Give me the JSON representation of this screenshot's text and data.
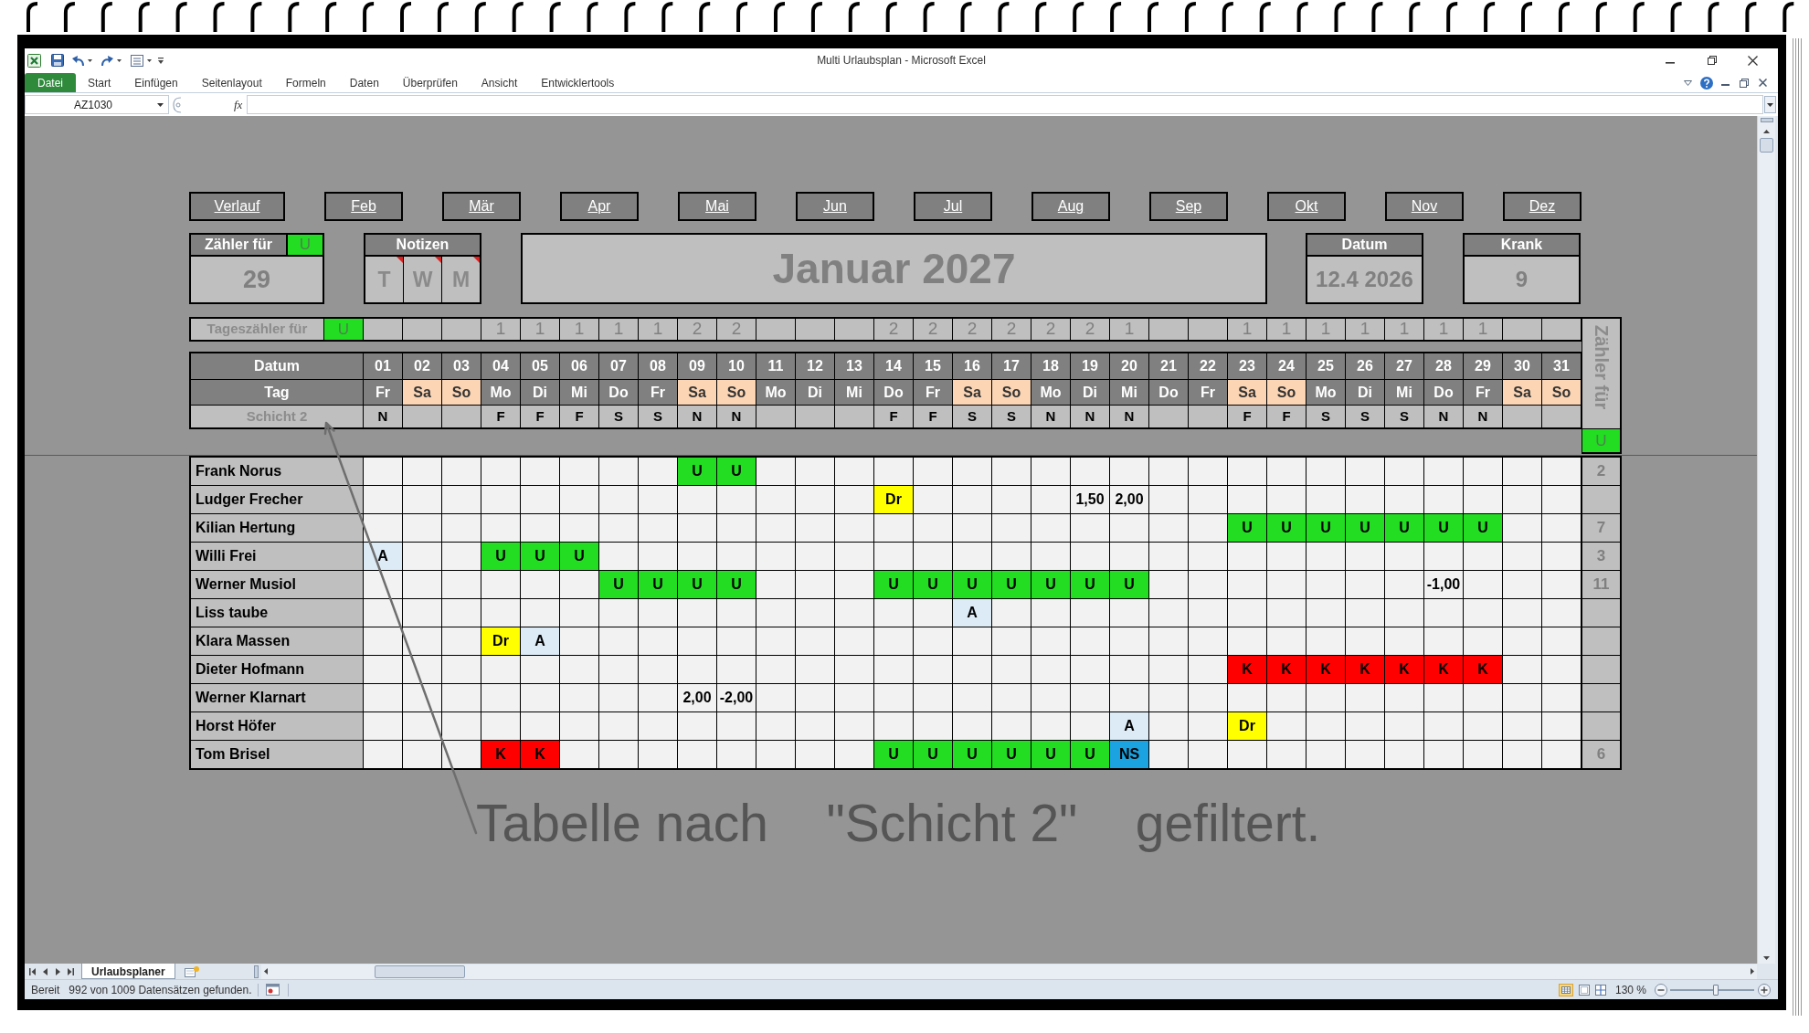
{
  "window": {
    "title": "Multi Urlaubsplan - Microsoft Excel"
  },
  "ribbon_tabs": [
    {
      "label": "Datei",
      "kind": "file"
    },
    {
      "label": "Start",
      "kind": "tab"
    },
    {
      "label": "Einfügen",
      "kind": "tab"
    },
    {
      "label": "Seitenlayout",
      "kind": "tab"
    },
    {
      "label": "Formeln",
      "kind": "tab"
    },
    {
      "label": "Daten",
      "kind": "tab"
    },
    {
      "label": "Überprüfen",
      "kind": "tab"
    },
    {
      "label": "Ansicht",
      "kind": "tab"
    },
    {
      "label": "Entwicklertools",
      "kind": "tab"
    }
  ],
  "formula_bar": {
    "name_box": "AZ1030",
    "function_button": "fx"
  },
  "month_nav": [
    "Verlauf",
    "Feb",
    "Mär",
    "Apr",
    "Mai",
    "Jun",
    "Jul",
    "Aug",
    "Sep",
    "Okt",
    "Nov",
    "Dez"
  ],
  "counter_box": {
    "title": "Zähler für",
    "code": "U",
    "value": "29"
  },
  "notes": {
    "title": "Notizen",
    "items": [
      {
        "label": "T",
        "comment": true
      },
      {
        "label": "W",
        "comment": true
      },
      {
        "label": "M",
        "comment": true
      }
    ]
  },
  "month_title": "Januar 2027",
  "date_box": {
    "title": "Datum",
    "value": "12.4 2026"
  },
  "sick_box": {
    "title": "Krank",
    "value": "9"
  },
  "day_counter": {
    "label": "Tageszähler für",
    "code": "U"
  },
  "table": {
    "header_labels": {
      "date": "Datum",
      "weekday": "Tag",
      "shift": "Schicht 2"
    },
    "days": [
      {
        "date": "01",
        "weekday": "Fr",
        "weekend": false,
        "shift": "N"
      },
      {
        "date": "02",
        "weekday": "Sa",
        "weekend": true
      },
      {
        "date": "03",
        "weekday": "So",
        "weekend": true
      },
      {
        "date": "04",
        "weekday": "Mo",
        "weekend": false,
        "count": "1",
        "shift": "F"
      },
      {
        "date": "05",
        "weekday": "Di",
        "weekend": false,
        "count": "1",
        "shift": "F"
      },
      {
        "date": "06",
        "weekday": "Mi",
        "weekend": false,
        "count": "1",
        "shift": "F"
      },
      {
        "date": "07",
        "weekday": "Do",
        "weekend": false,
        "count": "1",
        "shift": "S"
      },
      {
        "date": "08",
        "weekday": "Fr",
        "weekend": false,
        "count": "1",
        "shift": "S"
      },
      {
        "date": "09",
        "weekday": "Sa",
        "weekend": true,
        "count": "2",
        "shift": "N"
      },
      {
        "date": "10",
        "weekday": "So",
        "weekend": true,
        "count": "2",
        "shift": "N"
      },
      {
        "date": "11",
        "weekday": "Mo",
        "weekend": false
      },
      {
        "date": "12",
        "weekday": "Di",
        "weekend": false
      },
      {
        "date": "13",
        "weekday": "Mi",
        "weekend": false
      },
      {
        "date": "14",
        "weekday": "Do",
        "weekend": false,
        "count": "2",
        "shift": "F"
      },
      {
        "date": "15",
        "weekday": "Fr",
        "weekend": false,
        "count": "2",
        "shift": "F"
      },
      {
        "date": "16",
        "weekday": "Sa",
        "weekend": true,
        "count": "2",
        "shift": "S"
      },
      {
        "date": "17",
        "weekday": "So",
        "weekend": true,
        "count": "2",
        "shift": "S"
      },
      {
        "date": "18",
        "weekday": "Mo",
        "weekend": false,
        "count": "2",
        "shift": "N"
      },
      {
        "date": "19",
        "weekday": "Di",
        "weekend": false,
        "count": "2",
        "shift": "N"
      },
      {
        "date": "20",
        "weekday": "Mi",
        "weekend": false,
        "count": "1",
        "shift": "N"
      },
      {
        "date": "21",
        "weekday": "Do",
        "weekend": false
      },
      {
        "date": "22",
        "weekday": "Fr",
        "weekend": false
      },
      {
        "date": "23",
        "weekday": "Sa",
        "weekend": true,
        "count": "1",
        "shift": "F"
      },
      {
        "date": "24",
        "weekday": "So",
        "weekend": true,
        "count": "1",
        "shift": "F"
      },
      {
        "date": "25",
        "weekday": "Mo",
        "weekend": false,
        "count": "1",
        "shift": "S"
      },
      {
        "date": "26",
        "weekday": "Di",
        "weekend": false,
        "count": "1",
        "shift": "S"
      },
      {
        "date": "27",
        "weekday": "Mi",
        "weekend": false,
        "count": "1",
        "shift": "S"
      },
      {
        "date": "28",
        "weekday": "Do",
        "weekend": false,
        "count": "1",
        "shift": "N"
      },
      {
        "date": "29",
        "weekday": "Fr",
        "weekend": false,
        "count": "1",
        "shift": "N"
      },
      {
        "date": "30",
        "weekday": "Sa",
        "weekend": true
      },
      {
        "date": "31",
        "weekday": "So",
        "weekend": true
      }
    ],
    "counter_header": {
      "label": "Zähler für",
      "code": "U"
    },
    "rows": [
      {
        "name": "Frank Norus",
        "counter": "2",
        "cells": [
          {
            "kind": "blank"
          },
          {
            "kind": "blank"
          },
          {
            "kind": "blank"
          },
          {
            "kind": "blank"
          },
          {
            "kind": "blank"
          },
          {
            "kind": "blank"
          },
          {
            "kind": "blank"
          },
          {
            "kind": "blank"
          },
          {
            "kind": "code",
            "text": "U",
            "color": "#22dd22"
          },
          {
            "kind": "code",
            "text": "U",
            "color": "#22dd22"
          },
          {
            "kind": "blank"
          },
          {
            "kind": "blank"
          },
          {
            "kind": "blank"
          },
          {
            "kind": "blank"
          },
          {
            "kind": "blank"
          },
          {
            "kind": "blank"
          },
          {
            "kind": "blank"
          },
          {
            "kind": "blank"
          },
          {
            "kind": "blank"
          },
          {
            "kind": "blank"
          },
          {
            "kind": "blank"
          },
          {
            "kind": "blank"
          },
          {
            "kind": "blank"
          },
          {
            "kind": "blank"
          },
          {
            "kind": "blank"
          },
          {
            "kind": "blank"
          },
          {
            "kind": "blank"
          },
          {
            "kind": "blank"
          },
          {
            "kind": "blank"
          },
          {
            "kind": "blank"
          },
          {
            "kind": "blank"
          }
        ]
      },
      {
        "name": "Ludger Frecher",
        "cells": [
          {
            "kind": "blank"
          },
          {
            "kind": "blank"
          },
          {
            "kind": "blank"
          },
          {
            "kind": "blank"
          },
          {
            "kind": "blank"
          },
          {
            "kind": "blank"
          },
          {
            "kind": "blank"
          },
          {
            "kind": "blank"
          },
          {
            "kind": "blank"
          },
          {
            "kind": "blank"
          },
          {
            "kind": "blank"
          },
          {
            "kind": "blank"
          },
          {
            "kind": "blank"
          },
          {
            "kind": "code",
            "text": "Dr",
            "color": "#ffff00"
          },
          {
            "kind": "blank"
          },
          {
            "kind": "blank"
          },
          {
            "kind": "blank"
          },
          {
            "kind": "blank"
          },
          {
            "kind": "value",
            "text": "1,50"
          },
          {
            "kind": "value",
            "text": "2,00"
          },
          {
            "kind": "blank"
          },
          {
            "kind": "blank"
          },
          {
            "kind": "blank"
          },
          {
            "kind": "blank"
          },
          {
            "kind": "blank"
          },
          {
            "kind": "blank"
          },
          {
            "kind": "blank"
          },
          {
            "kind": "blank"
          },
          {
            "kind": "blank"
          },
          {
            "kind": "blank"
          },
          {
            "kind": "blank"
          }
        ]
      },
      {
        "name": "Kilian Hertung",
        "counter": "7",
        "cells": [
          {
            "kind": "blank"
          },
          {
            "kind": "blank"
          },
          {
            "kind": "blank"
          },
          {
            "kind": "blank"
          },
          {
            "kind": "blank"
          },
          {
            "kind": "blank"
          },
          {
            "kind": "blank"
          },
          {
            "kind": "blank"
          },
          {
            "kind": "blank"
          },
          {
            "kind": "blank"
          },
          {
            "kind": "blank"
          },
          {
            "kind": "blank"
          },
          {
            "kind": "blank"
          },
          {
            "kind": "blank"
          },
          {
            "kind": "blank"
          },
          {
            "kind": "blank"
          },
          {
            "kind": "blank"
          },
          {
            "kind": "blank"
          },
          {
            "kind": "blank"
          },
          {
            "kind": "blank"
          },
          {
            "kind": "blank"
          },
          {
            "kind": "blank"
          },
          {
            "kind": "code",
            "text": "U",
            "color": "#22dd22"
          },
          {
            "kind": "code",
            "text": "U",
            "color": "#22dd22"
          },
          {
            "kind": "code",
            "text": "U",
            "color": "#22dd22"
          },
          {
            "kind": "code",
            "text": "U",
            "color": "#22dd22"
          },
          {
            "kind": "code",
            "text": "U",
            "color": "#22dd22"
          },
          {
            "kind": "code",
            "text": "U",
            "color": "#22dd22"
          },
          {
            "kind": "code",
            "text": "U",
            "color": "#22dd22"
          },
          {
            "kind": "blank"
          },
          {
            "kind": "blank"
          }
        ]
      },
      {
        "name": "Willi Frei",
        "counter": "3",
        "cells": [
          {
            "kind": "code",
            "text": "A",
            "color": "#ddebf7"
          },
          {
            "kind": "blank"
          },
          {
            "kind": "blank"
          },
          {
            "kind": "code",
            "text": "U",
            "color": "#22dd22"
          },
          {
            "kind": "code",
            "text": "U",
            "color": "#22dd22"
          },
          {
            "kind": "code",
            "text": "U",
            "color": "#22dd22"
          },
          {
            "kind": "blank"
          },
          {
            "kind": "blank"
          },
          {
            "kind": "blank"
          },
          {
            "kind": "blank"
          },
          {
            "kind": "blank"
          },
          {
            "kind": "blank"
          },
          {
            "kind": "blank"
          },
          {
            "kind": "blank"
          },
          {
            "kind": "blank"
          },
          {
            "kind": "blank"
          },
          {
            "kind": "blank"
          },
          {
            "kind": "blank"
          },
          {
            "kind": "blank"
          },
          {
            "kind": "blank"
          },
          {
            "kind": "blank"
          },
          {
            "kind": "blank"
          },
          {
            "kind": "blank"
          },
          {
            "kind": "blank"
          },
          {
            "kind": "blank"
          },
          {
            "kind": "blank"
          },
          {
            "kind": "blank"
          },
          {
            "kind": "blank"
          },
          {
            "kind": "blank"
          },
          {
            "kind": "blank"
          },
          {
            "kind": "blank"
          }
        ]
      },
      {
        "name": "Werner Musiol",
        "counter": "11",
        "cells": [
          {
            "kind": "blank"
          },
          {
            "kind": "blank"
          },
          {
            "kind": "blank"
          },
          {
            "kind": "blank"
          },
          {
            "kind": "blank"
          },
          {
            "kind": "blank"
          },
          {
            "kind": "code",
            "text": "U",
            "color": "#22dd22"
          },
          {
            "kind": "code",
            "text": "U",
            "color": "#22dd22"
          },
          {
            "kind": "code",
            "text": "U",
            "color": "#22dd22"
          },
          {
            "kind": "code",
            "text": "U",
            "color": "#22dd22"
          },
          {
            "kind": "blank"
          },
          {
            "kind": "blank"
          },
          {
            "kind": "blank"
          },
          {
            "kind": "code",
            "text": "U",
            "color": "#22dd22"
          },
          {
            "kind": "code",
            "text": "U",
            "color": "#22dd22"
          },
          {
            "kind": "code",
            "text": "U",
            "color": "#22dd22"
          },
          {
            "kind": "code",
            "text": "U",
            "color": "#22dd22"
          },
          {
            "kind": "code",
            "text": "U",
            "color": "#22dd22"
          },
          {
            "kind": "code",
            "text": "U",
            "color": "#22dd22"
          },
          {
            "kind": "code",
            "text": "U",
            "color": "#22dd22"
          },
          {
            "kind": "blank"
          },
          {
            "kind": "blank"
          },
          {
            "kind": "blank"
          },
          {
            "kind": "blank"
          },
          {
            "kind": "blank"
          },
          {
            "kind": "blank"
          },
          {
            "kind": "blank"
          },
          {
            "kind": "value",
            "text": "-1,00"
          },
          {
            "kind": "blank"
          },
          {
            "kind": "blank"
          },
          {
            "kind": "blank"
          }
        ]
      },
      {
        "name": "Liss taube",
        "cells": [
          {
            "kind": "blank"
          },
          {
            "kind": "blank"
          },
          {
            "kind": "blank"
          },
          {
            "kind": "blank"
          },
          {
            "kind": "blank"
          },
          {
            "kind": "blank"
          },
          {
            "kind": "blank"
          },
          {
            "kind": "blank"
          },
          {
            "kind": "blank"
          },
          {
            "kind": "blank"
          },
          {
            "kind": "blank"
          },
          {
            "kind": "blank"
          },
          {
            "kind": "blank"
          },
          {
            "kind": "blank"
          },
          {
            "kind": "blank"
          },
          {
            "kind": "code",
            "text": "A",
            "color": "#ddebf7"
          },
          {
            "kind": "blank"
          },
          {
            "kind": "blank"
          },
          {
            "kind": "blank"
          },
          {
            "kind": "blank"
          },
          {
            "kind": "blank"
          },
          {
            "kind": "blank"
          },
          {
            "kind": "blank"
          },
          {
            "kind": "blank"
          },
          {
            "kind": "blank"
          },
          {
            "kind": "blank"
          },
          {
            "kind": "blank"
          },
          {
            "kind": "blank"
          },
          {
            "kind": "blank"
          },
          {
            "kind": "blank"
          },
          {
            "kind": "blank"
          }
        ]
      },
      {
        "name": "Klara Massen",
        "cells": [
          {
            "kind": "blank"
          },
          {
            "kind": "blank"
          },
          {
            "kind": "blank"
          },
          {
            "kind": "code",
            "text": "Dr",
            "color": "#ffff00"
          },
          {
            "kind": "code",
            "text": "A",
            "color": "#ddebf7"
          },
          {
            "kind": "blank"
          },
          {
            "kind": "blank"
          },
          {
            "kind": "blank"
          },
          {
            "kind": "blank"
          },
          {
            "kind": "blank"
          },
          {
            "kind": "blank"
          },
          {
            "kind": "blank"
          },
          {
            "kind": "blank"
          },
          {
            "kind": "blank"
          },
          {
            "kind": "blank"
          },
          {
            "kind": "blank"
          },
          {
            "kind": "blank"
          },
          {
            "kind": "blank"
          },
          {
            "kind": "blank"
          },
          {
            "kind": "blank"
          },
          {
            "kind": "blank"
          },
          {
            "kind": "blank"
          },
          {
            "kind": "blank"
          },
          {
            "kind": "blank"
          },
          {
            "kind": "blank"
          },
          {
            "kind": "blank"
          },
          {
            "kind": "blank"
          },
          {
            "kind": "blank"
          },
          {
            "kind": "blank"
          },
          {
            "kind": "blank"
          },
          {
            "kind": "blank"
          }
        ]
      },
      {
        "name": "Dieter Hofmann",
        "cells": [
          {
            "kind": "blank"
          },
          {
            "kind": "blank"
          },
          {
            "kind": "blank"
          },
          {
            "kind": "blank"
          },
          {
            "kind": "blank"
          },
          {
            "kind": "blank"
          },
          {
            "kind": "blank"
          },
          {
            "kind": "blank"
          },
          {
            "kind": "blank"
          },
          {
            "kind": "blank"
          },
          {
            "kind": "blank"
          },
          {
            "kind": "blank"
          },
          {
            "kind": "blank"
          },
          {
            "kind": "blank"
          },
          {
            "kind": "blank"
          },
          {
            "kind": "blank"
          },
          {
            "kind": "blank"
          },
          {
            "kind": "blank"
          },
          {
            "kind": "blank"
          },
          {
            "kind": "blank"
          },
          {
            "kind": "blank"
          },
          {
            "kind": "blank"
          },
          {
            "kind": "code",
            "text": "K",
            "color": "#ff0000"
          },
          {
            "kind": "code",
            "text": "K",
            "color": "#ff0000"
          },
          {
            "kind": "code",
            "text": "K",
            "color": "#ff0000"
          },
          {
            "kind": "code",
            "text": "K",
            "color": "#ff0000"
          },
          {
            "kind": "code",
            "text": "K",
            "color": "#ff0000"
          },
          {
            "kind": "code",
            "text": "K",
            "color": "#ff0000"
          },
          {
            "kind": "code",
            "text": "K",
            "color": "#ff0000"
          },
          {
            "kind": "blank"
          },
          {
            "kind": "blank"
          }
        ]
      },
      {
        "name": "Werner Klarnart",
        "cells": [
          {
            "kind": "blank"
          },
          {
            "kind": "blank"
          },
          {
            "kind": "blank"
          },
          {
            "kind": "blank"
          },
          {
            "kind": "blank"
          },
          {
            "kind": "blank"
          },
          {
            "kind": "blank"
          },
          {
            "kind": "blank"
          },
          {
            "kind": "value",
            "text": "2,00"
          },
          {
            "kind": "value",
            "text": "-2,00"
          },
          {
            "kind": "blank"
          },
          {
            "kind": "blank"
          },
          {
            "kind": "blank"
          },
          {
            "kind": "blank"
          },
          {
            "kind": "blank"
          },
          {
            "kind": "blank"
          },
          {
            "kind": "blank"
          },
          {
            "kind": "blank"
          },
          {
            "kind": "blank"
          },
          {
            "kind": "blank"
          },
          {
            "kind": "blank"
          },
          {
            "kind": "blank"
          },
          {
            "kind": "blank"
          },
          {
            "kind": "blank"
          },
          {
            "kind": "blank"
          },
          {
            "kind": "blank"
          },
          {
            "kind": "blank"
          },
          {
            "kind": "blank"
          },
          {
            "kind": "blank"
          },
          {
            "kind": "blank"
          },
          {
            "kind": "blank"
          }
        ]
      },
      {
        "name": "Horst Höfer",
        "cells": [
          {
            "kind": "blank"
          },
          {
            "kind": "blank"
          },
          {
            "kind": "blank"
          },
          {
            "kind": "blank"
          },
          {
            "kind": "blank"
          },
          {
            "kind": "blank"
          },
          {
            "kind": "blank"
          },
          {
            "kind": "blank"
          },
          {
            "kind": "blank"
          },
          {
            "kind": "blank"
          },
          {
            "kind": "blank"
          },
          {
            "kind": "blank"
          },
          {
            "kind": "blank"
          },
          {
            "kind": "blank"
          },
          {
            "kind": "blank"
          },
          {
            "kind": "blank"
          },
          {
            "kind": "blank"
          },
          {
            "kind": "blank"
          },
          {
            "kind": "blank"
          },
          {
            "kind": "code",
            "text": "A",
            "color": "#ddebf7"
          },
          {
            "kind": "blank"
          },
          {
            "kind": "blank"
          },
          {
            "kind": "code",
            "text": "Dr",
            "color": "#ffff00"
          },
          {
            "kind": "blank"
          },
          {
            "kind": "blank"
          },
          {
            "kind": "blank"
          },
          {
            "kind": "blank"
          },
          {
            "kind": "blank"
          },
          {
            "kind": "blank"
          },
          {
            "kind": "blank"
          },
          {
            "kind": "blank"
          }
        ]
      },
      {
        "name": "Tom Brisel",
        "counter": "6",
        "cells": [
          {
            "kind": "blank"
          },
          {
            "kind": "blank"
          },
          {
            "kind": "blank"
          },
          {
            "kind": "code",
            "text": "K",
            "color": "#ff0000"
          },
          {
            "kind": "code",
            "text": "K",
            "color": "#ff0000"
          },
          {
            "kind": "blank"
          },
          {
            "kind": "blank"
          },
          {
            "kind": "blank"
          },
          {
            "kind": "blank"
          },
          {
            "kind": "blank"
          },
          {
            "kind": "blank"
          },
          {
            "kind": "blank"
          },
          {
            "kind": "blank"
          },
          {
            "kind": "code",
            "text": "U",
            "color": "#22dd22"
          },
          {
            "kind": "code",
            "text": "U",
            "color": "#22dd22"
          },
          {
            "kind": "code",
            "text": "U",
            "color": "#22dd22"
          },
          {
            "kind": "code",
            "text": "U",
            "color": "#22dd22"
          },
          {
            "kind": "code",
            "text": "U",
            "color": "#22dd22"
          },
          {
            "kind": "code",
            "text": "U",
            "color": "#22dd22"
          },
          {
            "kind": "code",
            "text": "NS",
            "color": "#1aa3e0"
          },
          {
            "kind": "blank"
          },
          {
            "kind": "blank"
          },
          {
            "kind": "blank"
          },
          {
            "kind": "blank"
          },
          {
            "kind": "blank"
          },
          {
            "kind": "blank"
          },
          {
            "kind": "blank"
          },
          {
            "kind": "blank"
          },
          {
            "kind": "blank"
          },
          {
            "kind": "blank"
          },
          {
            "kind": "blank"
          }
        ]
      }
    ]
  },
  "annotation": "Tabelle nach    \"Schicht 2\"    gefiltert.",
  "sheet_tabs": [
    {
      "label": "Urlaubsplaner",
      "selected": true
    }
  ],
  "status_bar": {
    "mode": "Bereit",
    "message": "992 von 1009 Datensätzen gefunden.",
    "zoom": "130 %",
    "zoom_slider": {
      "level": 0.54
    }
  }
}
